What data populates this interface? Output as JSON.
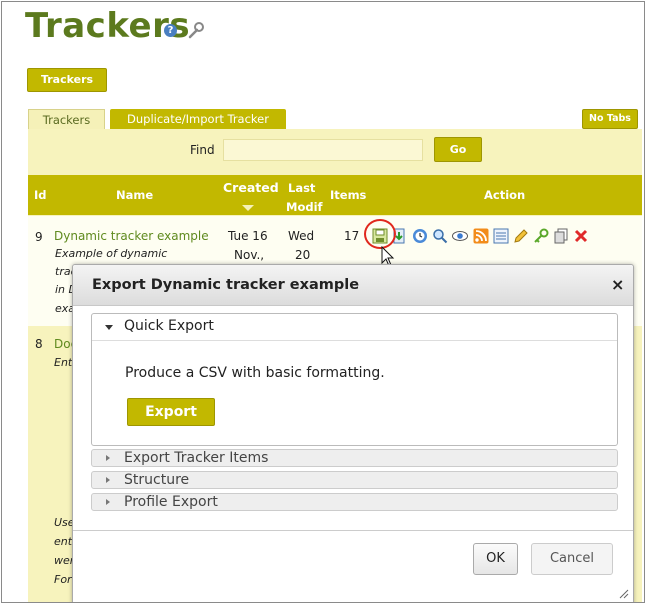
{
  "page": {
    "title": "Trackers",
    "help_icon": "question-circle-icon",
    "admin_icon": "wrench-icon"
  },
  "toolbar": {
    "trackers_button": "Trackers",
    "no_tabs_button": "No Tabs"
  },
  "tabs": [
    {
      "label": "Trackers",
      "active": true
    },
    {
      "label": "Duplicate/Import Tracker",
      "active": false
    }
  ],
  "find": {
    "label": "Find",
    "value": "",
    "go_label": "Go"
  },
  "table": {
    "headers": {
      "id": "Id",
      "name": "Name",
      "created": "Created",
      "last_modif_1": "Last",
      "last_modif_2": "Modif",
      "items": "Items",
      "action": "Action"
    },
    "rows": [
      {
        "id": "9",
        "name": "Dynamic tracker example",
        "desc_lines": [
          "Example of dynamic",
          "trac",
          "in D",
          "exa"
        ],
        "created_1": "Tue 16",
        "created_2": "Nov.,",
        "modif_1": "Wed",
        "modif_2": "20",
        "items": "17",
        "actions": [
          "export-icon",
          "import-icon",
          "clock-icon",
          "search-icon",
          "view-icon",
          "rss-icon",
          "list-icon",
          "edit-icon",
          "key-icon",
          "clone-icon",
          "delete-icon"
        ]
      },
      {
        "id": "8",
        "name": "Doc",
        "desc_lines": [
          "Ent",
          "Use",
          "ente",
          "wer",
          "For"
        ]
      }
    ]
  },
  "dialog": {
    "title": "Export Dynamic tracker example",
    "close": "×",
    "sections": [
      {
        "label": "Quick Export",
        "open": true,
        "description": "Produce a CSV with basic formatting.",
        "button": "Export"
      },
      {
        "label": "Export Tracker Items",
        "open": false
      },
      {
        "label": "Structure",
        "open": false
      },
      {
        "label": "Profile Export",
        "open": false
      }
    ],
    "ok_label": "OK",
    "cancel_label": "Cancel"
  },
  "colors": {
    "brand_green": "#5c7a1e",
    "olive_button": "#c2b800",
    "panel_bg": "#f7f3bd",
    "highlight_ring": "#e0281e"
  }
}
